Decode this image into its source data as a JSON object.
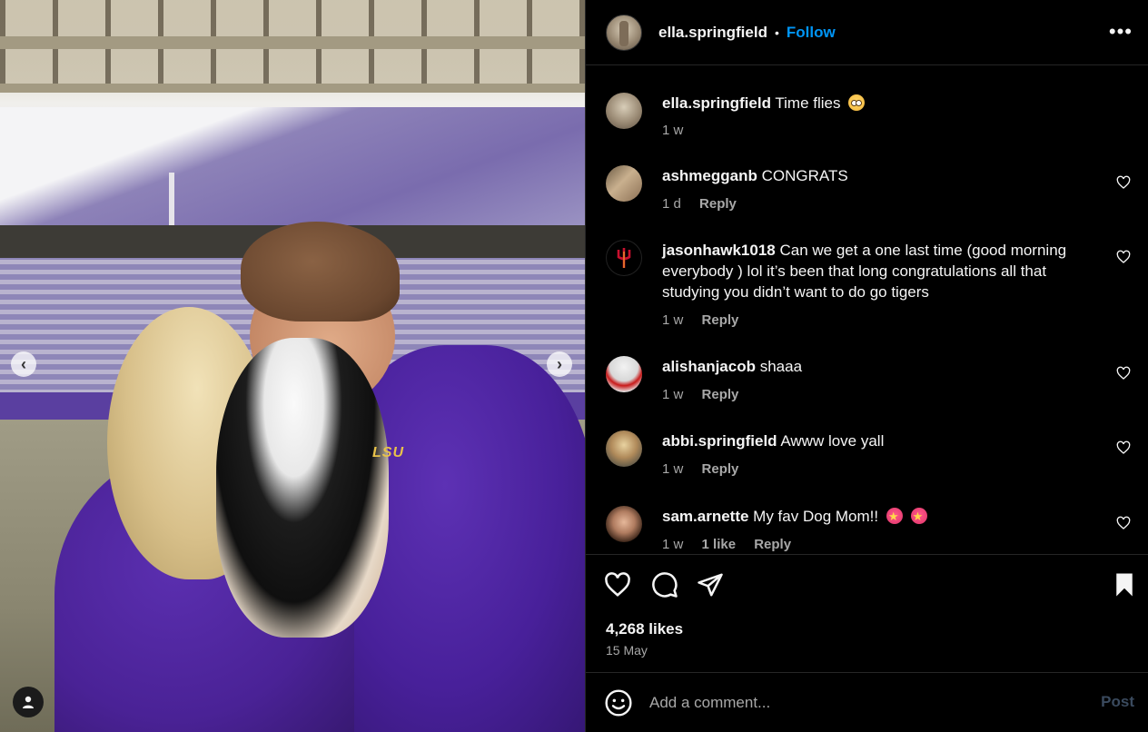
{
  "post": {
    "author": "ella.springfield",
    "follow_label": "Follow",
    "separator": "•",
    "more_label": "•••",
    "photo_text": "LSU"
  },
  "comments": [
    {
      "user": "ella.springfield",
      "text": "Time flies",
      "emoji": "🥹",
      "time": "1 w",
      "likes": "",
      "reply": ""
    },
    {
      "user": "ashmegganb",
      "text": "CONGRATS",
      "time": "1 d",
      "likes": "",
      "reply": "Reply"
    },
    {
      "user": "jasonhawk1018",
      "text": "Can we get a one last time (good morning everybody ) lol it’s been that long congratulations all that studying you didn’t want to do go tigers",
      "time": "1 w",
      "likes": "",
      "reply": "Reply"
    },
    {
      "user": "alishanjacob",
      "text": "shaaa",
      "time": "1 w",
      "likes": "",
      "reply": "Reply"
    },
    {
      "user": "abbi.springfield",
      "text": "Awww love yall",
      "time": "1 w",
      "likes": "",
      "reply": "Reply"
    },
    {
      "user": "sam.arnette",
      "text": "My fav Dog Mom!!",
      "emoji": "🤩 🤩",
      "time": "1 w",
      "likes": "1 like",
      "reply": "Reply"
    }
  ],
  "engagement": {
    "likes": "4,268 likes",
    "date": "15 May"
  },
  "composer": {
    "placeholder": "Add a comment...",
    "post_label": "Post"
  },
  "icons": {
    "like": "heart-icon",
    "comment": "comment-bubble-icon",
    "share": "paper-plane-icon",
    "save": "bookmark-icon",
    "emoji": "smiley-icon",
    "tag": "user-tag-icon",
    "prev": "chevron-left-icon",
    "next": "chevron-right-icon"
  },
  "colors": {
    "background": "#000000",
    "accent": "#0095f6",
    "muted_text": "#a8a8a8",
    "divider": "#262626"
  }
}
